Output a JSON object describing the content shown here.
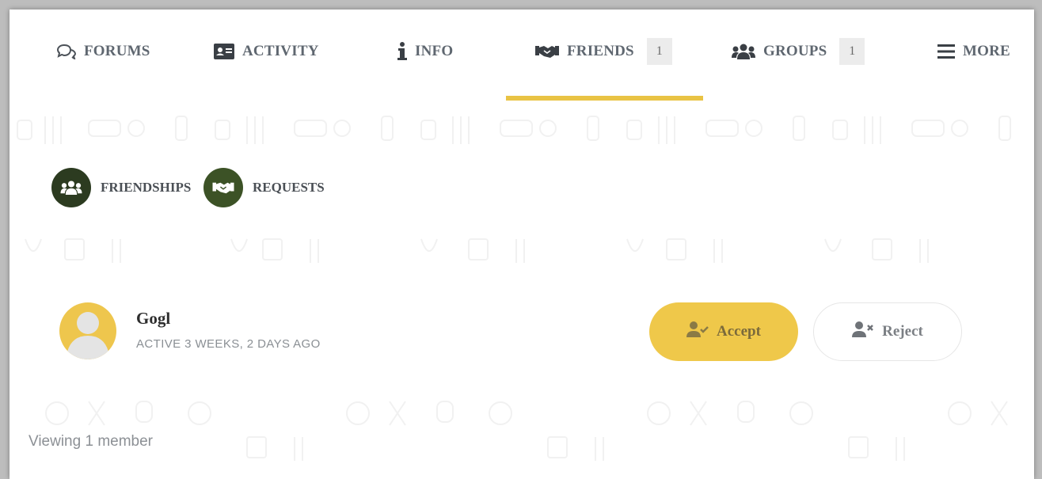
{
  "nav": {
    "forums_label": "FORUMS",
    "activity_label": "ACTIVITY",
    "info_label": "INFO",
    "friends_label": "FRIENDS",
    "friends_count": "1",
    "groups_label": "GROUPS",
    "groups_count": "1",
    "more_label": "MORE",
    "active_tab": "friends"
  },
  "subnav": {
    "friendships_label": "FRIENDSHIPS",
    "requests_label": "REQUESTS"
  },
  "request": {
    "name": "Gogl",
    "status": "ACTIVE 3 WEEKS, 2 DAYS AGO",
    "accept_label": "Accept",
    "reject_label": "Reject"
  },
  "footer": {
    "viewing_text": "Viewing 1 member"
  },
  "icons": {
    "forums": "chat-bubbles-icon",
    "activity": "id-card-icon",
    "info": "info-icon",
    "friends": "handshake-icon",
    "groups": "users-icon",
    "more": "hamburger-menu-icon",
    "accept": "user-check-icon",
    "reject": "user-times-icon"
  },
  "colors": {
    "accent": "#e9c344",
    "accept_button": "#efc84a",
    "subnav_icon_bg": "#2c3b20",
    "avatar_bg": "#eec64d"
  }
}
